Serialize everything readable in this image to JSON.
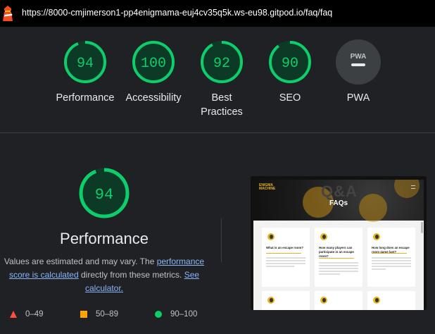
{
  "browser": {
    "url": "https://8000-cmjimerson1-pp4enigmama-euj4cv35q5k.ws-eu98.gitpod.io/faq/faq"
  },
  "gauges": [
    {
      "score": "94",
      "label": "Performance",
      "fraction": 0.94
    },
    {
      "score": "100",
      "label": "Accessibility",
      "fraction": 1.0
    },
    {
      "score": "92",
      "label": "Best Practices",
      "fraction": 0.92
    },
    {
      "score": "90",
      "label": "SEO",
      "fraction": 0.9
    },
    {
      "label": "PWA",
      "badge": "PWA"
    }
  ],
  "performance": {
    "score": "94",
    "fraction": 0.94,
    "title": "Performance",
    "desc_prefix": "Values are estimated and may vary. The ",
    "link1": "performance score is calculated",
    "desc_mid": " directly from these metrics. ",
    "link2": "See calculator."
  },
  "legend": {
    "fail": "0–49",
    "average": "50–89",
    "pass": "90–100"
  },
  "colors": {
    "pass": "#0cce6b",
    "average": "#ffa400",
    "fail": "#ff4e42",
    "track": "#0d3a26"
  },
  "screenshot": {
    "logo": "ENIGMA MACHINE",
    "hero_bg_text": "Q&A",
    "hero_title": "FAQs",
    "cards": [
      "What is an escape room?",
      "How many players can participate in an escape room?",
      "How long does an escape room game last?",
      "",
      "",
      ""
    ]
  }
}
